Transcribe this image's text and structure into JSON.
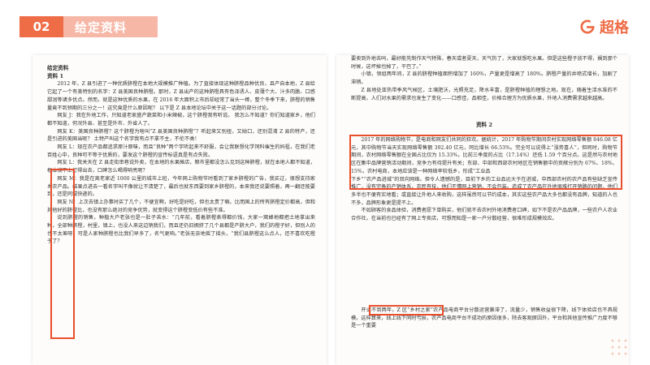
{
  "header": {
    "section_number": "02",
    "section_title": "给定资料",
    "brand": "超格"
  },
  "left_page": {
    "doc_title": "给定资料",
    "material_label": "资料 1",
    "para1": "2012 年，Z 县引进了一种优质脐橙在本地大规模推广种植。为了直接体现这种脐橙品种优良，且产自本地，Z 县给它起了一个有美特别的名字：Z 县美国良种脐橙。那时，Z 县出产的这种脐橙具有色泽诱人、皮薄个大、汁多肉脆、口感甜润等诸多优点。然而，就是这种优质的水果，在 2016 年大面积上市后却经常了当头一棒，整个冬季下来，脐橙的销售量竟不到预期的三分之一！这究竟是什么原因呢？ 以下是 Z 县本地论坛中关于这一话题的部分讨论。",
    "posts": [
      "网友 J：我在外地工作，只知道老家盛产蔬菜和小米辣椒，这个脐橙我有听说。 我怎么不知道？你们知道家乡，他们都不知道，何况外县、甚至是外市、外省人了。",
      "网友 K：美国良种脐橙？这个脐橙为啥叫“Z 县美国良种脐橙”？听起来又别扭，又拗口，还别混淆 Z 县的特产，还是引进的美国当呢？ 土特产叫这个名字我有点不拿不主，不伦不类！",
      "网友 L：现在农产品都追求原汁原味，而且“良种”两个字听起来不舒服，会让我联想化学饲料催生的妈祖，在我们老百姓心中，良种可不等于优质的，要发这个脐橙的宣传标语真是有点失败。",
      "网友 L：我关天在 Z 县走街串巷说外卖，在本地的水果摊店，粮市里都没怎么见到这种脐橙，就在本地人都不知道，根本谈不上打得出去，口碑怎么喝得响亮呢？",
      "网友 M：我是在离老家近 1000 公里的城市上班，今年网上购物节时看到了家乡脐橙的广告，我买过，很想支持家乡农产品。结果点进去一看名字叫不像就让不清楚了，最后也就东西要到家乡脐橙的，本来我还说要照着，再一翻还能要到，还是同城快递的。",
      "网友 N：上次去镇上办事时买了几个，不便宜啊，好吃是好吃，但也太贵了嘛。比而国上的所有脐橙定价都高，但和其他好的脐橙比，也没有那么绝对的竞争优势，就变得这个脐橙变低价有些不准。",
      "说到脐橙的销售，种植大户老张也是一肚子苦水：“几年前，看着脐橙表得都价钱，大家一窝蜂地都把土地拿出来种，全部种脐橙，村里，镇上，也没人来这边销我们，而且还仍旧拥挤了几个县都是产脐大户，我们的橙子好，但别人的也不太差呀，可是人家种脐橙也比我们早多了，名气更响。”老张无奈地摇了摇头，“我们县脐橙这么点人，还不喜欢吃橙子了？"
    ]
  },
  "right_page": {
    "top_text": "要卖到外地去吗，最好能先制作天气特殊，春天或者夏天，天气热了，大家就想吃水果。但是这些橙子放不得，搁到那个时候，这坏掉也掉了，干巴了。”",
    "para_b": "小镇，领组两年间，Z 县的脐橙种植面积增加了 160%，产量更是增高了 180%。脐橙产量的井喷式增长，加剧了滞销。",
    "para_c": "Z 县地处亚热带季风气候区，土壤肥沃，光照充足，降水丰富，是脐橙种植的理想之地。现在，随着生活水准的不断提高，人们对水果的需求也发生了变化——口感佳，品相佳，价格合理方为优质水果，外地人消费需求越来越高。",
    "material2_label": "资料 2",
    "highlight_para": "2017 年的网络购物节，是电商和网友们共同的狂欢。据统计，2017 年购物节期间农村实现网络零售额 846.08 亿元，其中购物节当天实现网络零售额 392.40 亿元，同比增长 66.53%。完全可以说得上“涨势喜人”，但同时，购物节期间，农村网络零售额在全国占比仅为 15.33%，比前三季度的占比（17.14%）还低 1.59 个百分点。这是然与农村地区在集中品牌营销活动期间，竞争力有待提升有关；东部、中部和西部农村地区在销售额中的贡献分别为 67%、18%、15%，农村电商，本地应该是一种网络率较低乡，形成“工业品",
    "para_d": "下乡”“农产品进城”的双向网络。但令人遗憾的是，目前下乡的工业品远大于在进城，中西部农村的农产品有些缺乏宣传推广，没有完备的产销体系，农民有技，他们不懂网上营销，不会包装。造成了农产品在外地很难打开销路的问题，他们多半也不便有实地看；或直接让外地人来收购，这样虽然可以节约成本，其实这些农产品大多也都没有品牌，知道的人也不多，品牌形象更是提不上。",
    "para_e": "不如顾客的食品体验，消费者愿下单购买，他们就不去农村外地消费者口碑，如下不是农产品品牌，一些农户人农业合作社，在当前也已经有了网上专卖店，可想而知是一家一户分散经营，很难形成规模效应。",
    "para_f": "开业不到两年，Z 区“乡村之家”农产品电商平台分散运营兼滞了，流量少，销售收益很下降，线下体验店也不具规模。这样算来，线上线下同时亏损，农产品电商平台不成功的原因很多，除去客观原因外，平台和其他宣传推广力度不够是一个重要",
    "para_f_highlight": "Z 区“乡村之家”"
  }
}
